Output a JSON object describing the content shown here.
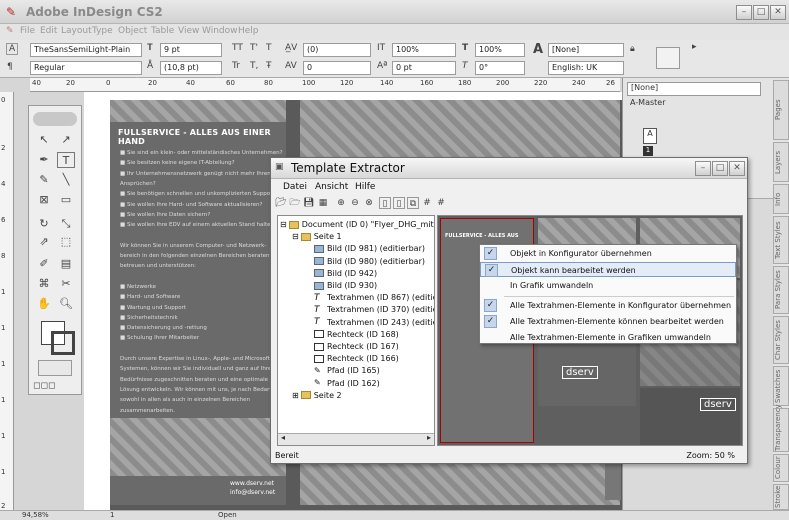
{
  "app": {
    "title": "Adobe InDesign CS2"
  },
  "menu": [
    "File",
    "Edit",
    "Layout",
    "Type",
    "Object",
    "Table",
    "View",
    "Window",
    "Help"
  ],
  "control": {
    "font_family": "TheSansSemiLight-Plain",
    "font_style": "Regular",
    "font_size": "9 pt",
    "leading": "(10,8 pt)",
    "kerning": "(0)",
    "tracking": "0",
    "scale_v": "100%",
    "scale_h": "100%",
    "baseline": "0 pt",
    "skew": "0°",
    "char_style": "[None]",
    "language": "English: UK",
    "tt1": "TT",
    "tt2": "T'",
    "tt3": "T",
    "tt4": "Tr",
    "tt5": "T,",
    "tt6": "Ŧ"
  },
  "ruler_h": [
    "40",
    "20",
    "0",
    "20",
    "40",
    "60",
    "80",
    "100",
    "120",
    "140",
    "160",
    "180",
    "200",
    "220",
    "240",
    "26"
  ],
  "ruler_v": [
    "0",
    "2",
    "4",
    "6",
    "8",
    "1",
    "1",
    "1",
    "1",
    "1",
    "1",
    "2"
  ],
  "page": {
    "heading": "FULLSERVICE - ALLES AUS EINER HAND",
    "lines": [
      "■ Sie sind ein klein- oder mittelständisches Unternehmen?",
      "■ Sie besitzen keine eigene IT-Abteilung?",
      "■ Ihr Unternehmensnetzwerk genügt nicht mehr Ihren",
      "   Ansprüchen?",
      "■ Sie benötigen schnellen und unkomplizierten Support?",
      "■ Sie wollen Ihre Hard- und Software aktualisieren?",
      "■ Sie wollen Ihre Daten sichern?",
      "■ Sie wollen Ihre EDV auf einem aktuellen Stand halten?",
      "",
      "Wir können Sie in unserem Computer- und Netzwerk-",
      "bereich in den folgenden einzelnen Bereichen beraten,",
      "betreuen und unterstützen:",
      "",
      "■ Netzwerke",
      "■ Hard- und Software",
      "■ Wartung und Support",
      "■ Sicherheitstechnik",
      "■ Datensicherung und -rettung",
      "■ Schulung Ihrer Mitarbeiter",
      "",
      "Durch unsere Expertise in Linux-, Apple- und Microsoft-",
      "Systemen, können wir Sie individuell und ganz auf Ihre",
      "Bedürfnisse zugeschnitten beraten und eine optimale",
      "Lösung entwickeln. Wir können mit uns, je nach Bedarf,",
      "sowohl in allen als auch in einzelnen Bereichen",
      "zusammenarbeiten."
    ],
    "web": "www.dserv.net",
    "mail": "info@dserv.net"
  },
  "panels": {
    "pages_none": "[None]",
    "pages_master": "A-Master",
    "page_icon": "A",
    "page_num": "1",
    "tabs": [
      "Pages",
      "Layers",
      "Info",
      "Text Styles",
      "Para Styles",
      "Char Styles",
      "Swatches",
      "Transparency",
      "Colour",
      "Stroke"
    ]
  },
  "status": {
    "zoom": "94,58%",
    "page": "1",
    "open": "Open"
  },
  "extractor": {
    "title": "Template Extractor",
    "menu": [
      "Datei",
      "Ansicht",
      "Hilfe"
    ],
    "tree": [
      {
        "label": "Document (ID 0) \"Flyer_DHG_mitBild\"",
        "level": 0,
        "icon": "folder",
        "expander": "⊟"
      },
      {
        "label": "Seite 1",
        "level": 1,
        "icon": "folder",
        "expander": "⊟"
      },
      {
        "label": "Bild (ID 981) (editierbar)",
        "level": 2,
        "icon": "image"
      },
      {
        "label": "Bild (ID 980) (editierbar)",
        "level": 2,
        "icon": "image"
      },
      {
        "label": "Bild (ID 942)",
        "level": 2,
        "icon": "image"
      },
      {
        "label": "Bild (ID 930)",
        "level": 2,
        "icon": "image"
      },
      {
        "label": "Textrahmen (ID 867) (editierbar)",
        "level": 2,
        "icon": "text"
      },
      {
        "label": "Textrahmen (ID 370) (editierbar)",
        "level": 2,
        "icon": "text"
      },
      {
        "label": "Textrahmen (ID 243) (editierbar)",
        "level": 2,
        "icon": "text"
      },
      {
        "label": "Rechteck (ID 168)",
        "level": 2,
        "icon": "rect"
      },
      {
        "label": "Rechteck (ID 167)",
        "level": 2,
        "icon": "rect"
      },
      {
        "label": "Rechteck (ID 166)",
        "level": 2,
        "icon": "rect"
      },
      {
        "label": "Pfad (ID 165)",
        "level": 2,
        "icon": "path"
      },
      {
        "label": "Pfad (ID 162)",
        "level": 2,
        "icon": "path"
      },
      {
        "label": "Seite 2",
        "level": 1,
        "icon": "folder",
        "expander": "⊞"
      }
    ],
    "status": "Bereit",
    "zoom": "Zoom: 50 %",
    "preview_heading": "FULLSERVICE - ALLES AUS",
    "logo": "dserv",
    "context_menu": [
      {
        "label": "Objekt in Konfigurator übernehmen",
        "checked": true
      },
      {
        "label": "Objekt kann bearbeitet werden",
        "checked": true,
        "highlight": true
      },
      {
        "label": "In Grafik umwandeln",
        "checked": false
      },
      {
        "label": "Alle Textrahmen-Elemente in Konfigurator übernehmen",
        "checked": true
      },
      {
        "label": "Alle Textrahmen-Elemente können bearbeitet werden",
        "checked": true
      },
      {
        "label": "Alle Textrahmen-Elemente in Grafiken umwandeln",
        "checked": false
      }
    ]
  }
}
